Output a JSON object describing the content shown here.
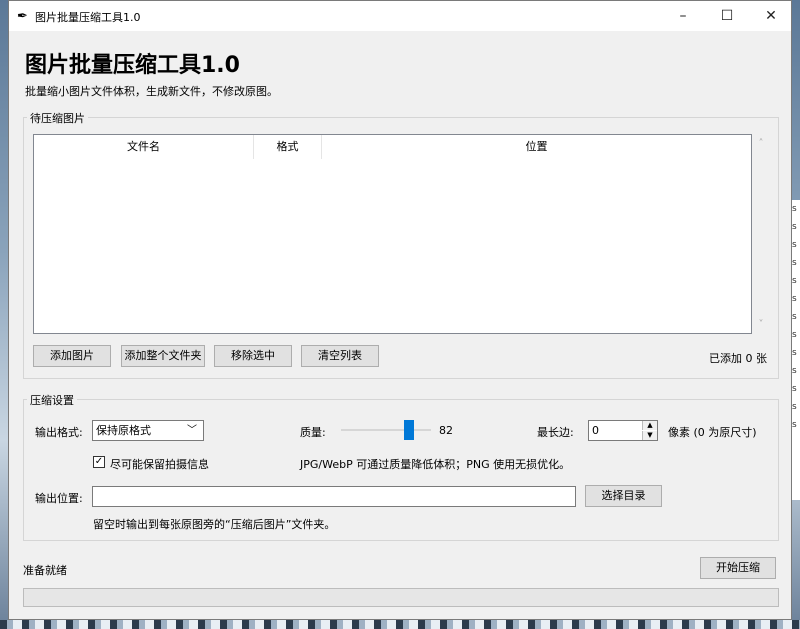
{
  "window": {
    "title": "图片批量压缩工具1.0",
    "minimize": "–",
    "maximize": "☐",
    "close": "✕"
  },
  "header": {
    "title": "图片批量压缩工具1.0",
    "subtitle": "批量缩小图片文件体积，生成新文件，不修改原图。"
  },
  "pending": {
    "group_label": "待压缩图片",
    "columns": [
      "文件名",
      "格式",
      "位置"
    ],
    "rows": [],
    "buttons": {
      "add_images": "添加图片",
      "add_folder": "添加整个文件夹",
      "remove_selected": "移除选中",
      "clear_list": "清空列表"
    },
    "count_text": "已添加 0 张"
  },
  "settings": {
    "group_label": "压缩设置",
    "output_format_label": "输出格式:",
    "output_format_value": "保持原格式",
    "quality_label": "质量:",
    "quality_value": "82",
    "quality_fraction": 0.82,
    "max_edge_label": "最长边:",
    "max_edge_value": "0",
    "max_edge_unit": "像素 (0 为原尺寸)",
    "keep_exif_label": "尽可能保留拍摄信息",
    "keep_exif_checked": true,
    "hint": "JPG/WebP 可通过质量降低体积；PNG 使用无损优化。",
    "output_location_label": "输出位置:",
    "output_location_value": "",
    "choose_dir_button": "选择目录",
    "output_hint": "留空时输出到每张原图旁的“压缩后图片”文件夹。"
  },
  "footer": {
    "status": "准备就绪",
    "start_button": "开始压缩",
    "progress": 0
  },
  "colors": {
    "accent": "#0078d7",
    "window_bg": "#f0f0f0"
  }
}
